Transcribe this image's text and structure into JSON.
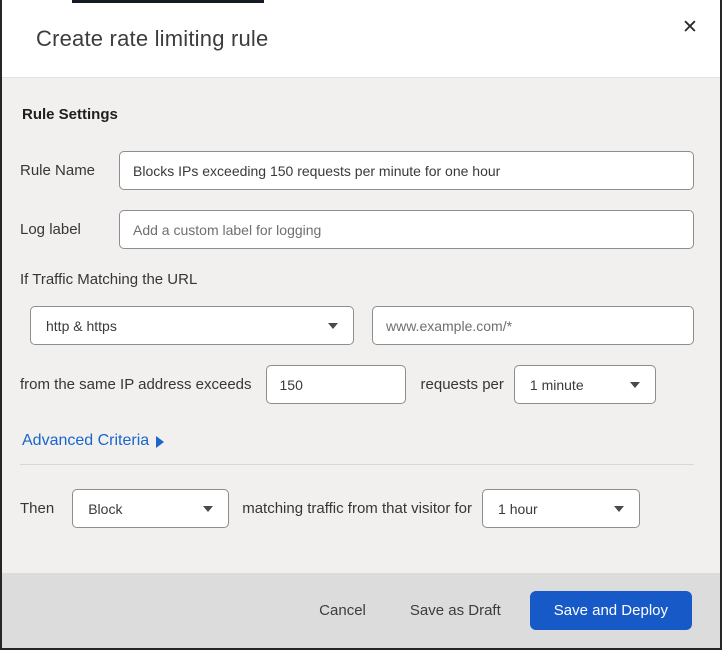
{
  "dialog": {
    "title": "Create rate limiting rule",
    "close_glyph": "✕"
  },
  "rule_settings": {
    "heading": "Rule Settings",
    "rule_name": {
      "label": "Rule Name",
      "value": "Blocks IPs exceeding 150 requests per minute for one hour"
    },
    "log_label": {
      "label": "Log label",
      "placeholder": "Add a custom label for logging"
    },
    "traffic_match": {
      "intro": "If Traffic Matching the URL",
      "scheme_selected": "http & https",
      "url_placeholder": "www.example.com/*",
      "threshold_prefix": "from the same IP address exceeds",
      "threshold_value": "150",
      "threshold_suffix": "requests per",
      "period_selected": "1 minute"
    },
    "advanced_criteria_label": "Advanced Criteria"
  },
  "then_section": {
    "label": "Then",
    "action_selected": "Block",
    "middle_text": "matching traffic from that visitor for",
    "duration_selected": "1 hour"
  },
  "footer": {
    "cancel_label": "Cancel",
    "save_draft_label": "Save as Draft",
    "save_deploy_label": "Save and Deploy"
  },
  "colors": {
    "primary_button_blue": "#1659c7",
    "link_blue": "#1966cc",
    "body_background": "#f1f0ef",
    "footer_background": "#dcdcdc"
  }
}
